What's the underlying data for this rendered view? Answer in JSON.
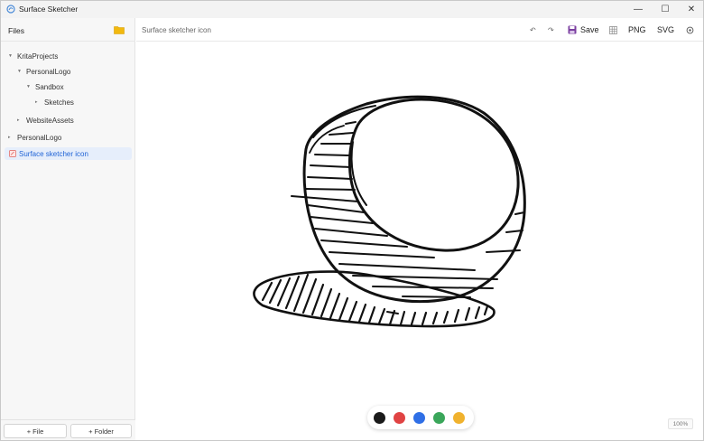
{
  "window": {
    "title": "Surface Sketcher",
    "min_glyph": "—",
    "max_glyph": "☐",
    "close_glyph": "✕"
  },
  "sidebar": {
    "title": "Files",
    "tree": [
      {
        "label": "KritaProjects",
        "depth": 0,
        "caret": "▼"
      },
      {
        "label": "PersonalLogo",
        "depth": 1,
        "caret": "▼"
      },
      {
        "label": "Sandbox",
        "depth": 2,
        "caret": "▼"
      },
      {
        "label": "Sketches",
        "depth": 3,
        "caret": "▸"
      },
      {
        "label": "WebsiteAssets",
        "depth": 1,
        "caret": "▸"
      },
      {
        "label": "PersonalLogo",
        "depth": 0,
        "caret": "▸"
      },
      {
        "label": "Surface sketcher icon",
        "depth": 0,
        "selected": true
      }
    ],
    "add_file_label": "+ File",
    "add_folder_label": "+ Folder"
  },
  "toolbar": {
    "doc_title": "Surface sketcher icon",
    "undo_glyph": "↶",
    "redo_glyph": "↷",
    "save_label": "Save",
    "png_label": "PNG",
    "svg_label": "SVG"
  },
  "palette": {
    "colors": [
      "#1a1a1a",
      "#e04343",
      "#2f6fe6",
      "#3aa65a",
      "#f0b22e"
    ]
  },
  "zoom_label": "100%",
  "icons": {
    "app": "surface-sketcher-icon",
    "folder": "folder-icon",
    "save": "floppy-disk-icon",
    "grid": "grid-icon",
    "settings": "gear-icon"
  }
}
